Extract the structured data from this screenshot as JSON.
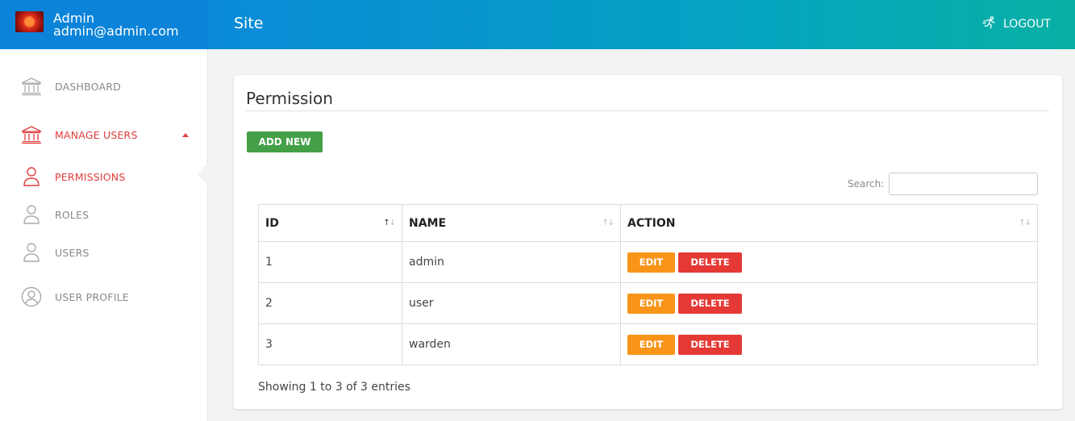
{
  "user": {
    "name": "Admin",
    "email": "admin@admin.com"
  },
  "topbar": {
    "site_title": "Site",
    "logout_label": "LOGOUT"
  },
  "sidebar": {
    "items": [
      {
        "label": "DASHBOARD",
        "icon": "bank-icon",
        "active": false
      },
      {
        "label": "MANAGE USERS",
        "icon": "bank-icon",
        "active": true,
        "expanded": true
      },
      {
        "label": "PERMISSIONS",
        "icon": "user-icon",
        "active": true
      },
      {
        "label": "ROLES",
        "icon": "user-icon",
        "active": false
      },
      {
        "label": "USERS",
        "icon": "user-icon",
        "active": false
      },
      {
        "label": "USER PROFILE",
        "icon": "user-circle-icon",
        "active": false
      }
    ]
  },
  "page": {
    "title": "Permission",
    "add_button": "ADD NEW",
    "search_label": "Search:",
    "search_value": "",
    "table": {
      "headers": [
        "ID",
        "NAME",
        "ACTION"
      ],
      "rows": [
        {
          "id": "1",
          "name": "admin",
          "edit": "EDIT",
          "delete": "DELETE"
        },
        {
          "id": "2",
          "name": "user",
          "edit": "EDIT",
          "delete": "DELETE"
        },
        {
          "id": "3",
          "name": "warden",
          "edit": "EDIT",
          "delete": "DELETE"
        }
      ]
    },
    "info": "Showing 1 to 3 of 3 entries"
  },
  "colors": {
    "accent_red": "#e23d3d",
    "add_green": "#43a047",
    "edit_orange": "#f89519",
    "delete_red": "#e53935",
    "topbar_start": "#0a8ad8",
    "topbar_end": "#07b0a4"
  }
}
